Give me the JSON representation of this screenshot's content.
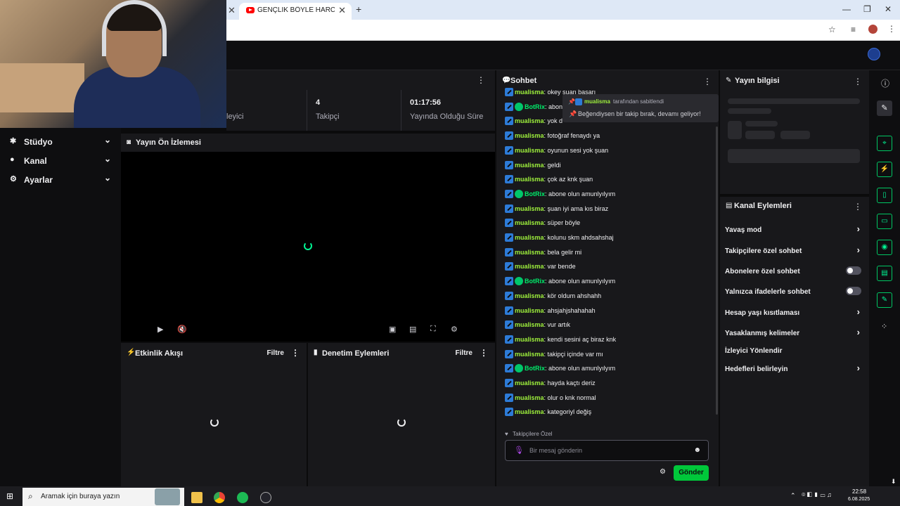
{
  "browser": {
    "tab_title": "GENÇLİK BÖYLE HARCANIYOR",
    "tab_close": "✕",
    "new_tab": "+",
    "close_left": "✕",
    "win_min": "—",
    "win_max": "❐",
    "win_close": "✕"
  },
  "sidebar": {
    "items": [
      {
        "label": "Stüdyo",
        "icon": "gear-icon"
      },
      {
        "label": "Kanal",
        "icon": "user-icon"
      },
      {
        "label": "Ayarlar",
        "icon": "gear-icon"
      }
    ]
  },
  "stats": {
    "partial_label": "leyici",
    "followers_value": "4",
    "followers_label": "Takipçi",
    "uptime_value": "01:17:56",
    "uptime_label": "Yayında Olduğu Süre"
  },
  "preview": {
    "title": "Yayın Ön İzlemesi"
  },
  "activity": {
    "title": "Etkinlik Akışı",
    "filter": "Filtre"
  },
  "modactions": {
    "title": "Denetim Eylemleri",
    "filter": "Filtre"
  },
  "chat": {
    "title": "Sohbet",
    "pinned_by_user": "mualisma",
    "pinned_by_suffix": "tarafından sabitlendi",
    "pinned_message": "Beğendiysen bir takip bırak, devamı geliyor!",
    "messages": [
      {
        "user": "mualisma",
        "text": "okey şuan başarı",
        "bot": false
      },
      {
        "user": "BotRix",
        "text": "abone",
        "bot": true
      },
      {
        "user": "mualisma",
        "text": "yok d",
        "bot": false
      },
      {
        "user": "mualisma",
        "text": "fotoğraf fenaydı ya",
        "bot": false
      },
      {
        "user": "mualisma",
        "text": "oyunun sesi yok şuan",
        "bot": false
      },
      {
        "user": "mualisma",
        "text": "geldi",
        "bot": false
      },
      {
        "user": "mualisma",
        "text": "çok az knk şuan",
        "bot": false
      },
      {
        "user": "BotRix",
        "text": "abone olun amunlyılyım",
        "bot": true
      },
      {
        "user": "mualisma",
        "text": "şuan iyi ama kıs biraz",
        "bot": false
      },
      {
        "user": "mualisma",
        "text": "süper böyle",
        "bot": false
      },
      {
        "user": "mualisma",
        "text": "kolunu skm ahdsahshaj",
        "bot": false
      },
      {
        "user": "mualisma",
        "text": "bela gelir mi",
        "bot": false
      },
      {
        "user": "mualisma",
        "text": "var bende",
        "bot": false
      },
      {
        "user": "BotRix",
        "text": "abone olun amunlyılyım",
        "bot": true
      },
      {
        "user": "mualisma",
        "text": "kör oldum ahshahh",
        "bot": false
      },
      {
        "user": "mualisma",
        "text": "ahsjahjshahahah",
        "bot": false
      },
      {
        "user": "mualisma",
        "text": "vur artık",
        "bot": false
      },
      {
        "user": "mualisma",
        "text": "kendi sesini aç biraz knk",
        "bot": false
      },
      {
        "user": "mualisma",
        "text": "takipçi içinde var mı",
        "bot": false
      },
      {
        "user": "BotRix",
        "text": "abone olun amunlyılyım",
        "bot": true
      },
      {
        "user": "mualisma",
        "text": "hayda kaçtı deriz",
        "bot": false
      },
      {
        "user": "mualisma",
        "text": "olur o knk normal",
        "bot": false
      },
      {
        "user": "mualisma",
        "text": "kategoriyl değiş",
        "bot": false
      }
    ],
    "mode_label": "Takipçilere Özel",
    "input_placeholder": "Bir mesaj gönderin",
    "send_label": "Gönder"
  },
  "stream_info": {
    "title": "Yayın bilgisi"
  },
  "channel_actions": {
    "title": "Kanal Eylemleri",
    "items": [
      {
        "label": "Yavaş mod",
        "control": "arrow"
      },
      {
        "label": "Takipçilere özel sohbet",
        "control": "arrow"
      },
      {
        "label": "Abonelere özel sohbet",
        "control": "toggle"
      },
      {
        "label": "Yalnızca ifadelerle sohbet",
        "control": "toggle"
      },
      {
        "label": "Hesap yaşı kısıtlaması",
        "control": "arrow"
      },
      {
        "label": "Yasaklanmış kelimeler",
        "control": "arrow"
      },
      {
        "label": "İzleyici Yönlendir",
        "control": "none"
      },
      {
        "label": "Hedefleri belirleyin",
        "control": "arrow"
      }
    ]
  },
  "taskbar": {
    "search_placeholder": "Aramak için buraya yazın",
    "time": "22:58",
    "date": "6.08.2025"
  },
  "colors": {
    "accent": "#00f593",
    "button": "#00c73a",
    "username": "#9ef03c"
  }
}
